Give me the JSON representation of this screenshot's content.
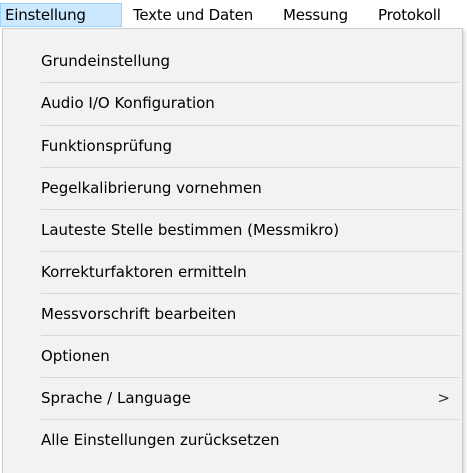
{
  "menubar": {
    "items": [
      {
        "label": "Einstellung",
        "active": true
      },
      {
        "label": "Texte und Daten"
      },
      {
        "label": "Messung"
      },
      {
        "label": "Protokoll"
      }
    ]
  },
  "dropdown": {
    "items": [
      {
        "label": "Grundeinstellung"
      },
      {
        "label": "Audio I/O Konfiguration"
      },
      {
        "label": "Funktionsprüfung"
      },
      {
        "label": "Pegelkalibrierung vornehmen"
      },
      {
        "label": "Lauteste Stelle bestimmen (Messmikro)"
      },
      {
        "label": "Korrekturfaktoren ermitteln"
      },
      {
        "label": "Messvorschrift bearbeiten"
      },
      {
        "label": "Optionen"
      },
      {
        "label": "Sprache / Language",
        "submenu_arrow": ">"
      },
      {
        "label": "Alle Einstellungen zurücksetzen"
      }
    ]
  },
  "colors": {
    "active_menu_bg": "#cce8ff",
    "active_menu_border": "#99d1ff",
    "dropdown_bg": "#f2f2f2"
  }
}
